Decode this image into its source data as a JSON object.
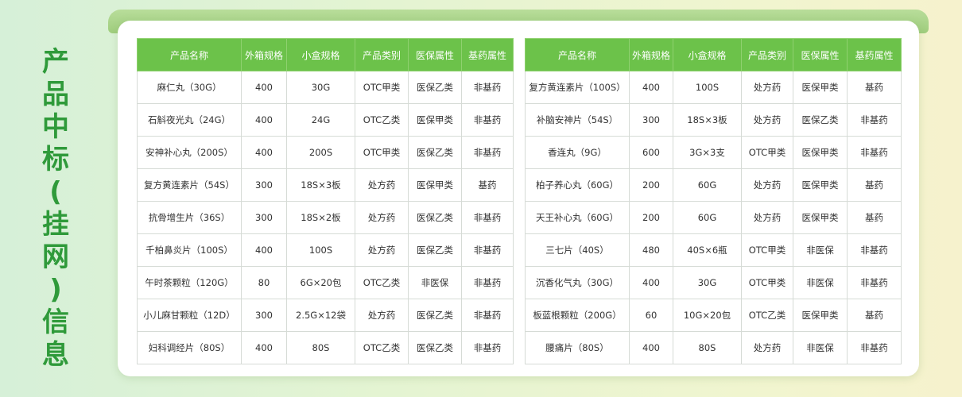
{
  "side_title": [
    "产",
    "品",
    "中",
    "标",
    "(",
    "挂",
    "网",
    ")",
    "信",
    "息"
  ],
  "headers": [
    "产品名称",
    "外箱规格",
    "小盒规格",
    "产品类别",
    "医保属性",
    "基药属性"
  ],
  "left_rows": [
    [
      "麻仁丸（30G）",
      "400",
      "30G",
      "OTC甲类",
      "医保乙类",
      "非基药"
    ],
    [
      "石斛夜光丸（24G）",
      "400",
      "24G",
      "OTC乙类",
      "医保甲类",
      "非基药"
    ],
    [
      "安神补心丸（200S）",
      "400",
      "200S",
      "OTC甲类",
      "医保乙类",
      "非基药"
    ],
    [
      "复方黄连素片（54S）",
      "300",
      "18S×3板",
      "处方药",
      "医保甲类",
      "基药"
    ],
    [
      "抗骨增生片（36S）",
      "300",
      "18S×2板",
      "处方药",
      "医保乙类",
      "非基药"
    ],
    [
      "千柏鼻炎片（100S）",
      "400",
      "100S",
      "处方药",
      "医保乙类",
      "非基药"
    ],
    [
      "午时茶颗粒（120G）",
      "80",
      "6G×20包",
      "OTC乙类",
      "非医保",
      "非基药"
    ],
    [
      "小儿麻甘颗粒（12D）",
      "300",
      "2.5G×12袋",
      "处方药",
      "医保乙类",
      "非基药"
    ],
    [
      "妇科调经片（80S）",
      "400",
      "80S",
      "OTC乙类",
      "医保乙类",
      "非基药"
    ]
  ],
  "right_rows": [
    [
      "复方黄连素片（100S）",
      "400",
      "100S",
      "处方药",
      "医保甲类",
      "基药"
    ],
    [
      "补脑安神片（54S）",
      "300",
      "18S×3板",
      "处方药",
      "医保乙类",
      "非基药"
    ],
    [
      "香连丸（9G）",
      "600",
      "3G×3支",
      "OTC甲类",
      "医保甲类",
      "非基药"
    ],
    [
      "柏子养心丸（60G）",
      "200",
      "60G",
      "处方药",
      "医保甲类",
      "基药"
    ],
    [
      "天王补心丸（60G）",
      "200",
      "60G",
      "处方药",
      "医保甲类",
      "基药"
    ],
    [
      "三七片（40S）",
      "480",
      "40S×6瓶",
      "OTC甲类",
      "非医保",
      "非基药"
    ],
    [
      "沉香化气丸（30G）",
      "400",
      "30G",
      "OTC甲类",
      "非医保",
      "非基药"
    ],
    [
      "板蓝根颗粒（200G）",
      "60",
      "10G×20包",
      "OTC乙类",
      "医保甲类",
      "基药"
    ],
    [
      "腰痛片（80S）",
      "400",
      "80S",
      "处方药",
      "非医保",
      "非基药"
    ]
  ]
}
